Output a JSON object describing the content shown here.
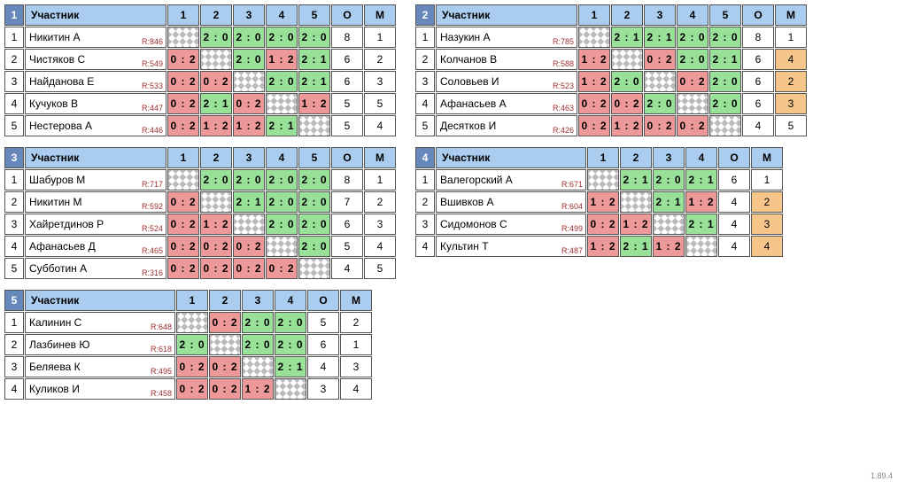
{
  "version": "1.89.4",
  "headers": {
    "participant": "Участник",
    "points": "О",
    "place": "М"
  },
  "groups": [
    {
      "num": "1",
      "cols": [
        "1",
        "2",
        "3",
        "4",
        "5"
      ],
      "rows": [
        {
          "idx": "1",
          "name": "Никитин А",
          "rating": "R:846",
          "cells": [
            null,
            {
              "s": "2 : 0",
              "r": "w"
            },
            {
              "s": "2 : 0",
              "r": "w"
            },
            {
              "s": "2 : 0",
              "r": "w"
            },
            {
              "s": "2 : 0",
              "r": "w"
            }
          ],
          "pts": "8",
          "place": "1",
          "hl": false
        },
        {
          "idx": "2",
          "name": "Чистяков С",
          "rating": "R:549",
          "cells": [
            {
              "s": "0 : 2",
              "r": "l"
            },
            null,
            {
              "s": "2 : 0",
              "r": "w"
            },
            {
              "s": "1 : 2",
              "r": "l"
            },
            {
              "s": "2 : 1",
              "r": "w"
            }
          ],
          "pts": "6",
          "place": "2",
          "hl": false
        },
        {
          "idx": "3",
          "name": "Найданова Е",
          "rating": "R:533",
          "cells": [
            {
              "s": "0 : 2",
              "r": "l"
            },
            {
              "s": "0 : 2",
              "r": "l"
            },
            null,
            {
              "s": "2 : 0",
              "r": "w"
            },
            {
              "s": "2 : 1",
              "r": "w"
            }
          ],
          "pts": "6",
          "place": "3",
          "hl": false
        },
        {
          "idx": "4",
          "name": "Кучуков В",
          "rating": "R:447",
          "cells": [
            {
              "s": "0 : 2",
              "r": "l"
            },
            {
              "s": "2 : 1",
              "r": "w"
            },
            {
              "s": "0 : 2",
              "r": "l"
            },
            null,
            {
              "s": "1 : 2",
              "r": "l"
            }
          ],
          "pts": "5",
          "place": "5",
          "hl": false
        },
        {
          "idx": "5",
          "name": "Нестерова А",
          "rating": "R:446",
          "cells": [
            {
              "s": "0 : 2",
              "r": "l"
            },
            {
              "s": "1 : 2",
              "r": "l"
            },
            {
              "s": "1 : 2",
              "r": "l"
            },
            {
              "s": "2 : 1",
              "r": "w"
            },
            null
          ],
          "pts": "5",
          "place": "4",
          "hl": false
        }
      ]
    },
    {
      "num": "2",
      "cols": [
        "1",
        "2",
        "3",
        "4",
        "5"
      ],
      "rows": [
        {
          "idx": "1",
          "name": "Назукин А",
          "rating": "R:785",
          "cells": [
            null,
            {
              "s": "2 : 1",
              "r": "w"
            },
            {
              "s": "2 : 1",
              "r": "w"
            },
            {
              "s": "2 : 0",
              "r": "w"
            },
            {
              "s": "2 : 0",
              "r": "w"
            }
          ],
          "pts": "8",
          "place": "1",
          "hl": false
        },
        {
          "idx": "2",
          "name": "Колчанов В",
          "rating": "R:588",
          "cells": [
            {
              "s": "1 : 2",
              "r": "l"
            },
            null,
            {
              "s": "0 : 2",
              "r": "l"
            },
            {
              "s": "2 : 0",
              "r": "w"
            },
            {
              "s": "2 : 1",
              "r": "w"
            }
          ],
          "pts": "6",
          "place": "4",
          "hl": true
        },
        {
          "idx": "3",
          "name": "Соловьев И",
          "rating": "R:523",
          "cells": [
            {
              "s": "1 : 2",
              "r": "l"
            },
            {
              "s": "2 : 0",
              "r": "w"
            },
            null,
            {
              "s": "0 : 2",
              "r": "l"
            },
            {
              "s": "2 : 0",
              "r": "w"
            }
          ],
          "pts": "6",
          "place": "2",
          "hl": true
        },
        {
          "idx": "4",
          "name": "Афанасьев А",
          "rating": "R:463",
          "cells": [
            {
              "s": "0 : 2",
              "r": "l"
            },
            {
              "s": "0 : 2",
              "r": "l"
            },
            {
              "s": "2 : 0",
              "r": "w"
            },
            null,
            {
              "s": "2 : 0",
              "r": "w"
            }
          ],
          "pts": "6",
          "place": "3",
          "hl": true
        },
        {
          "idx": "5",
          "name": "Десятков И",
          "rating": "R:426",
          "cells": [
            {
              "s": "0 : 2",
              "r": "l"
            },
            {
              "s": "1 : 2",
              "r": "l"
            },
            {
              "s": "0 : 2",
              "r": "l"
            },
            {
              "s": "0 : 2",
              "r": "l"
            },
            null
          ],
          "pts": "4",
          "place": "5",
          "hl": false
        }
      ]
    },
    {
      "num": "3",
      "cols": [
        "1",
        "2",
        "3",
        "4",
        "5"
      ],
      "rows": [
        {
          "idx": "1",
          "name": "Шабуров М",
          "rating": "R:717",
          "cells": [
            null,
            {
              "s": "2 : 0",
              "r": "w"
            },
            {
              "s": "2 : 0",
              "r": "w"
            },
            {
              "s": "2 : 0",
              "r": "w"
            },
            {
              "s": "2 : 0",
              "r": "w"
            }
          ],
          "pts": "8",
          "place": "1",
          "hl": false
        },
        {
          "idx": "2",
          "name": "Никитин М",
          "rating": "R:592",
          "cells": [
            {
              "s": "0 : 2",
              "r": "l"
            },
            null,
            {
              "s": "2 : 1",
              "r": "w"
            },
            {
              "s": "2 : 0",
              "r": "w"
            },
            {
              "s": "2 : 0",
              "r": "w"
            }
          ],
          "pts": "7",
          "place": "2",
          "hl": false
        },
        {
          "idx": "3",
          "name": "Хайретдинов Р",
          "rating": "R:524",
          "cells": [
            {
              "s": "0 : 2",
              "r": "l"
            },
            {
              "s": "1 : 2",
              "r": "l"
            },
            null,
            {
              "s": "2 : 0",
              "r": "w"
            },
            {
              "s": "2 : 0",
              "r": "w"
            }
          ],
          "pts": "6",
          "place": "3",
          "hl": false
        },
        {
          "idx": "4",
          "name": "Афанасьев Д",
          "rating": "R:465",
          "cells": [
            {
              "s": "0 : 2",
              "r": "l"
            },
            {
              "s": "0 : 2",
              "r": "l"
            },
            {
              "s": "0 : 2",
              "r": "l"
            },
            null,
            {
              "s": "2 : 0",
              "r": "w"
            }
          ],
          "pts": "5",
          "place": "4",
          "hl": false
        },
        {
          "idx": "5",
          "name": "Субботин А",
          "rating": "R:316",
          "cells": [
            {
              "s": "0 : 2",
              "r": "l"
            },
            {
              "s": "0 : 2",
              "r": "l"
            },
            {
              "s": "0 : 2",
              "r": "l"
            },
            {
              "s": "0 : 2",
              "r": "l"
            },
            null
          ],
          "pts": "4",
          "place": "5",
          "hl": false
        }
      ]
    },
    {
      "num": "4",
      "cols": [
        "1",
        "2",
        "3",
        "4"
      ],
      "rows": [
        {
          "idx": "1",
          "name": "Валегорский А",
          "rating": "R:671",
          "cells": [
            null,
            {
              "s": "2 : 1",
              "r": "w"
            },
            {
              "s": "2 : 0",
              "r": "w"
            },
            {
              "s": "2 : 1",
              "r": "w"
            }
          ],
          "pts": "6",
          "place": "1",
          "hl": false
        },
        {
          "idx": "2",
          "name": "Вшивков А",
          "rating": "R:604",
          "cells": [
            {
              "s": "1 : 2",
              "r": "l"
            },
            null,
            {
              "s": "2 : 1",
              "r": "w"
            },
            {
              "s": "1 : 2",
              "r": "l"
            }
          ],
          "pts": "4",
          "place": "2",
          "hl": true
        },
        {
          "idx": "3",
          "name": "Сидомонов С",
          "rating": "R:499",
          "cells": [
            {
              "s": "0 : 2",
              "r": "l"
            },
            {
              "s": "1 : 2",
              "r": "l"
            },
            null,
            {
              "s": "2 : 1",
              "r": "w"
            }
          ],
          "pts": "4",
          "place": "3",
          "hl": true
        },
        {
          "idx": "4",
          "name": "Культин Т",
          "rating": "R:487",
          "cells": [
            {
              "s": "1 : 2",
              "r": "l"
            },
            {
              "s": "2 : 1",
              "r": "w"
            },
            {
              "s": "1 : 2",
              "r": "l"
            },
            null
          ],
          "pts": "4",
          "place": "4",
          "hl": true
        }
      ]
    },
    {
      "num": "5",
      "cols": [
        "1",
        "2",
        "3",
        "4"
      ],
      "rows": [
        {
          "idx": "1",
          "name": "Калинин С",
          "rating": "R:648",
          "cells": [
            null,
            {
              "s": "0 : 2",
              "r": "l"
            },
            {
              "s": "2 : 0",
              "r": "w"
            },
            {
              "s": "2 : 0",
              "r": "w"
            }
          ],
          "pts": "5",
          "place": "2",
          "hl": false
        },
        {
          "idx": "2",
          "name": "Лазбинев Ю",
          "rating": "R:618",
          "cells": [
            {
              "s": "2 : 0",
              "r": "w"
            },
            null,
            {
              "s": "2 : 0",
              "r": "w"
            },
            {
              "s": "2 : 0",
              "r": "w"
            }
          ],
          "pts": "6",
          "place": "1",
          "hl": false
        },
        {
          "idx": "3",
          "name": "Беляева К",
          "rating": "R:495",
          "cells": [
            {
              "s": "0 : 2",
              "r": "l"
            },
            {
              "s": "0 : 2",
              "r": "l"
            },
            null,
            {
              "s": "2 : 1",
              "r": "w"
            }
          ],
          "pts": "4",
          "place": "3",
          "hl": false
        },
        {
          "idx": "4",
          "name": "Куликов И",
          "rating": "R:458",
          "cells": [
            {
              "s": "0 : 2",
              "r": "l"
            },
            {
              "s": "0 : 2",
              "r": "l"
            },
            {
              "s": "1 : 2",
              "r": "l"
            },
            null
          ],
          "pts": "3",
          "place": "4",
          "hl": false
        }
      ]
    }
  ]
}
